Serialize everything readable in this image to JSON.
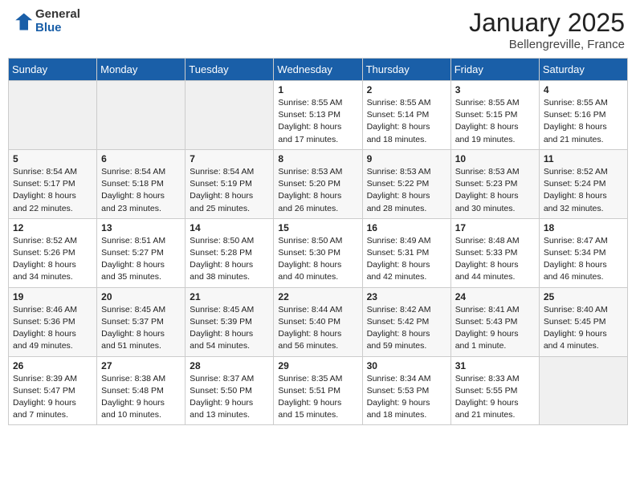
{
  "header": {
    "logo_general": "General",
    "logo_blue": "Blue",
    "month": "January 2025",
    "location": "Bellengreville, France"
  },
  "weekdays": [
    "Sunday",
    "Monday",
    "Tuesday",
    "Wednesday",
    "Thursday",
    "Friday",
    "Saturday"
  ],
  "weeks": [
    [
      {
        "day": "",
        "info": ""
      },
      {
        "day": "",
        "info": ""
      },
      {
        "day": "",
        "info": ""
      },
      {
        "day": "1",
        "info": "Sunrise: 8:55 AM\nSunset: 5:13 PM\nDaylight: 8 hours\nand 17 minutes."
      },
      {
        "day": "2",
        "info": "Sunrise: 8:55 AM\nSunset: 5:14 PM\nDaylight: 8 hours\nand 18 minutes."
      },
      {
        "day": "3",
        "info": "Sunrise: 8:55 AM\nSunset: 5:15 PM\nDaylight: 8 hours\nand 19 minutes."
      },
      {
        "day": "4",
        "info": "Sunrise: 8:55 AM\nSunset: 5:16 PM\nDaylight: 8 hours\nand 21 minutes."
      }
    ],
    [
      {
        "day": "5",
        "info": "Sunrise: 8:54 AM\nSunset: 5:17 PM\nDaylight: 8 hours\nand 22 minutes."
      },
      {
        "day": "6",
        "info": "Sunrise: 8:54 AM\nSunset: 5:18 PM\nDaylight: 8 hours\nand 23 minutes."
      },
      {
        "day": "7",
        "info": "Sunrise: 8:54 AM\nSunset: 5:19 PM\nDaylight: 8 hours\nand 25 minutes."
      },
      {
        "day": "8",
        "info": "Sunrise: 8:53 AM\nSunset: 5:20 PM\nDaylight: 8 hours\nand 26 minutes."
      },
      {
        "day": "9",
        "info": "Sunrise: 8:53 AM\nSunset: 5:22 PM\nDaylight: 8 hours\nand 28 minutes."
      },
      {
        "day": "10",
        "info": "Sunrise: 8:53 AM\nSunset: 5:23 PM\nDaylight: 8 hours\nand 30 minutes."
      },
      {
        "day": "11",
        "info": "Sunrise: 8:52 AM\nSunset: 5:24 PM\nDaylight: 8 hours\nand 32 minutes."
      }
    ],
    [
      {
        "day": "12",
        "info": "Sunrise: 8:52 AM\nSunset: 5:26 PM\nDaylight: 8 hours\nand 34 minutes."
      },
      {
        "day": "13",
        "info": "Sunrise: 8:51 AM\nSunset: 5:27 PM\nDaylight: 8 hours\nand 35 minutes."
      },
      {
        "day": "14",
        "info": "Sunrise: 8:50 AM\nSunset: 5:28 PM\nDaylight: 8 hours\nand 38 minutes."
      },
      {
        "day": "15",
        "info": "Sunrise: 8:50 AM\nSunset: 5:30 PM\nDaylight: 8 hours\nand 40 minutes."
      },
      {
        "day": "16",
        "info": "Sunrise: 8:49 AM\nSunset: 5:31 PM\nDaylight: 8 hours\nand 42 minutes."
      },
      {
        "day": "17",
        "info": "Sunrise: 8:48 AM\nSunset: 5:33 PM\nDaylight: 8 hours\nand 44 minutes."
      },
      {
        "day": "18",
        "info": "Sunrise: 8:47 AM\nSunset: 5:34 PM\nDaylight: 8 hours\nand 46 minutes."
      }
    ],
    [
      {
        "day": "19",
        "info": "Sunrise: 8:46 AM\nSunset: 5:36 PM\nDaylight: 8 hours\nand 49 minutes."
      },
      {
        "day": "20",
        "info": "Sunrise: 8:45 AM\nSunset: 5:37 PM\nDaylight: 8 hours\nand 51 minutes."
      },
      {
        "day": "21",
        "info": "Sunrise: 8:45 AM\nSunset: 5:39 PM\nDaylight: 8 hours\nand 54 minutes."
      },
      {
        "day": "22",
        "info": "Sunrise: 8:44 AM\nSunset: 5:40 PM\nDaylight: 8 hours\nand 56 minutes."
      },
      {
        "day": "23",
        "info": "Sunrise: 8:42 AM\nSunset: 5:42 PM\nDaylight: 8 hours\nand 59 minutes."
      },
      {
        "day": "24",
        "info": "Sunrise: 8:41 AM\nSunset: 5:43 PM\nDaylight: 9 hours\nand 1 minute."
      },
      {
        "day": "25",
        "info": "Sunrise: 8:40 AM\nSunset: 5:45 PM\nDaylight: 9 hours\nand 4 minutes."
      }
    ],
    [
      {
        "day": "26",
        "info": "Sunrise: 8:39 AM\nSunset: 5:47 PM\nDaylight: 9 hours\nand 7 minutes."
      },
      {
        "day": "27",
        "info": "Sunrise: 8:38 AM\nSunset: 5:48 PM\nDaylight: 9 hours\nand 10 minutes."
      },
      {
        "day": "28",
        "info": "Sunrise: 8:37 AM\nSunset: 5:50 PM\nDaylight: 9 hours\nand 13 minutes."
      },
      {
        "day": "29",
        "info": "Sunrise: 8:35 AM\nSunset: 5:51 PM\nDaylight: 9 hours\nand 15 minutes."
      },
      {
        "day": "30",
        "info": "Sunrise: 8:34 AM\nSunset: 5:53 PM\nDaylight: 9 hours\nand 18 minutes."
      },
      {
        "day": "31",
        "info": "Sunrise: 8:33 AM\nSunset: 5:55 PM\nDaylight: 9 hours\nand 21 minutes."
      },
      {
        "day": "",
        "info": ""
      }
    ]
  ]
}
